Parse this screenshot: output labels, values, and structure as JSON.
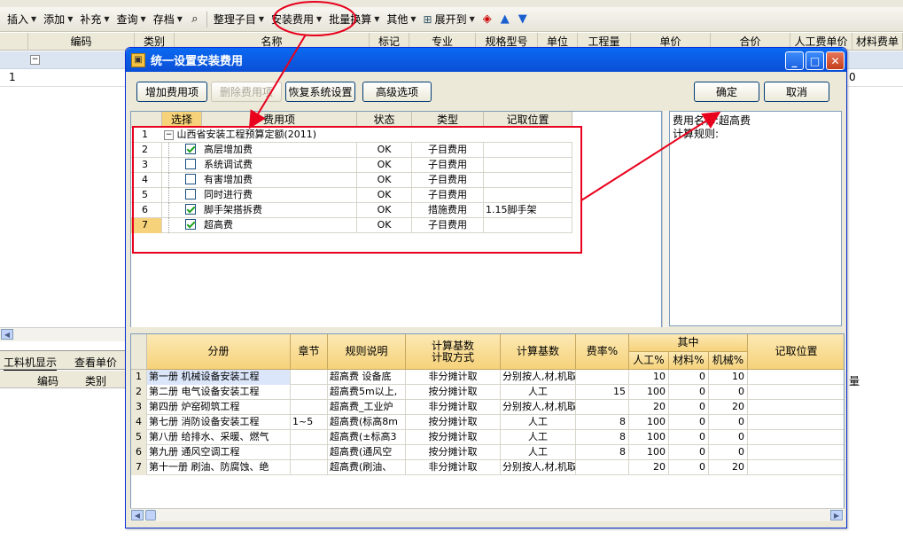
{
  "toolbar": {
    "items": [
      "插入",
      "添加",
      "补充",
      "查询",
      "存档"
    ],
    "items2": [
      "整理子目",
      "安装费用",
      "批量换算",
      "其他"
    ],
    "expand_label": "展开到"
  },
  "background": {
    "headers": [
      "编码",
      "类别",
      "名称",
      "标记",
      "专业",
      "规格型号",
      "单位",
      "工程量",
      "单价",
      "合价",
      "人工费单价",
      "材料费单"
    ],
    "row1_num": "1",
    "row1_tail": "0",
    "tabs": [
      "工料机显示",
      "查看单价构"
    ],
    "headers2": [
      "编码",
      "类别"
    ],
    "right_tail": "量"
  },
  "dialog": {
    "title": "统一设置安装费用",
    "buttons": {
      "add": "增加费用项",
      "delete": "删除费用项",
      "restore": "恢复系统设置",
      "advanced": "高级选项",
      "ok": "确定",
      "cancel": "取消"
    },
    "upper_grid": {
      "headers": [
        "选择",
        "费用项",
        "状态",
        "类型",
        "记取位置"
      ],
      "group": {
        "num": "1",
        "label": "山西省安装工程预算定额(2011)"
      },
      "rows": [
        {
          "num": "2",
          "checked": true,
          "name": "高层增加费",
          "status": "OK",
          "type": "子目费用",
          "pos": ""
        },
        {
          "num": "3",
          "checked": false,
          "name": "系统调试费",
          "status": "OK",
          "type": "子目费用",
          "pos": ""
        },
        {
          "num": "4",
          "checked": false,
          "name": "有害增加费",
          "status": "OK",
          "type": "子目费用",
          "pos": ""
        },
        {
          "num": "5",
          "checked": false,
          "name": "同时进行费",
          "status": "OK",
          "type": "子目费用",
          "pos": ""
        },
        {
          "num": "6",
          "checked": true,
          "name": "脚手架搭拆费",
          "status": "OK",
          "type": "措施费用",
          "pos": "1.15脚手架"
        },
        {
          "num": "7",
          "checked": true,
          "name": "超高费",
          "status": "OK",
          "type": "子目费用",
          "pos": ""
        }
      ]
    },
    "right_panel": {
      "fee_name": "费用名称:超高费",
      "calc_rule": "计算规则:"
    },
    "lower_grid": {
      "headers": {
        "volume": "分册",
        "chapter": "章节",
        "rule": "规则说明",
        "method": "计算基数\n计取方式",
        "base": "计算基数",
        "rate": "费率%",
        "among": "其中",
        "labor": "人工%",
        "material": "材料%",
        "machine": "机械%",
        "pos": "记取位置"
      },
      "rows": [
        {
          "num": "1",
          "volume": "第一册 机械设备安装工程",
          "chapter": "",
          "rule": "超高费 设备底",
          "method": "非分摊计取",
          "base": "分别按人,材,机取费",
          "rate": "",
          "labor": "10",
          "material": "0",
          "machine": "10"
        },
        {
          "num": "2",
          "volume": "第二册 电气设备安装工程",
          "chapter": "",
          "rule": "超高费5m以上,",
          "method": "按分摊计取",
          "base": "人工",
          "rate": "15",
          "labor": "100",
          "material": "0",
          "machine": "0"
        },
        {
          "num": "3",
          "volume": "第四册 炉窑砌筑工程",
          "chapter": "",
          "rule": "超高费_工业炉",
          "method": "非分摊计取",
          "base": "分别按人,材,机取费",
          "rate": "",
          "labor": "20",
          "material": "0",
          "machine": "20"
        },
        {
          "num": "4",
          "volume": "第七册 消防设备安装工程",
          "chapter": "1~5",
          "rule": "超高费(标高8m",
          "method": "按分摊计取",
          "base": "人工",
          "rate": "8",
          "labor": "100",
          "material": "0",
          "machine": "0"
        },
        {
          "num": "5",
          "volume": "第八册 给排水、采暖、燃气",
          "chapter": "",
          "rule": "超高费(±标高3",
          "method": "按分摊计取",
          "base": "人工",
          "rate": "8",
          "labor": "100",
          "material": "0",
          "machine": "0"
        },
        {
          "num": "6",
          "volume": "第九册 通风空调工程",
          "chapter": "",
          "rule": "超高费(通风空",
          "method": "按分摊计取",
          "base": "人工",
          "rate": "8",
          "labor": "100",
          "material": "0",
          "machine": "0"
        },
        {
          "num": "7",
          "volume": "第十一册 刷油、防腐蚀、绝",
          "chapter": "",
          "rule": "超高费(刷油、",
          "method": "非分摊计取",
          "base": "分别按人,材,机取费",
          "rate": "",
          "labor": "20",
          "material": "0",
          "machine": "20"
        }
      ]
    }
  },
  "colors": {
    "annotation": "#e8001c",
    "title_blue": "#0a5fe6",
    "header_orange": "#f6d27a"
  }
}
